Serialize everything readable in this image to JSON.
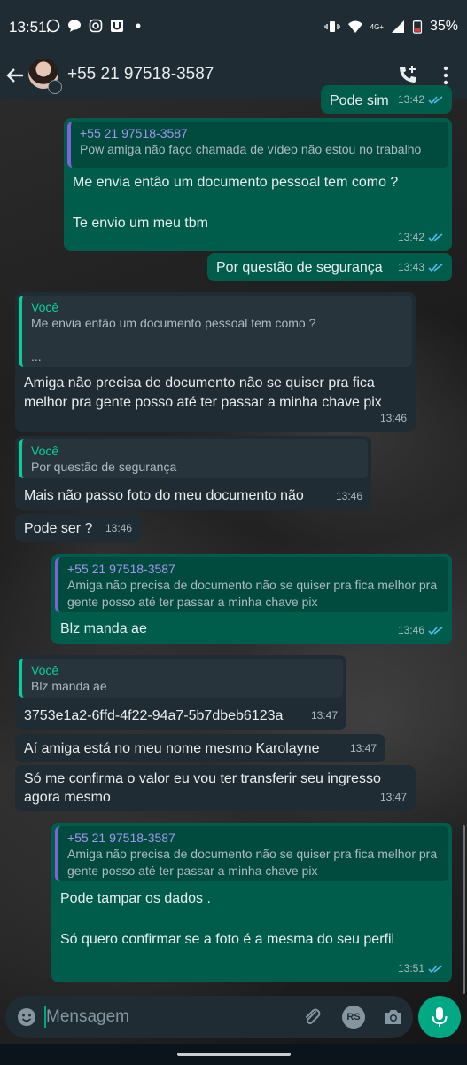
{
  "status_bar": {
    "time": "13:51",
    "network": "4G+",
    "battery": "35%"
  },
  "header": {
    "contact_name": "+55 21 97518-3587"
  },
  "messages": [
    {
      "dir": "out",
      "text": "Pode sim",
      "time": "13:42"
    },
    {
      "dir": "out",
      "quote_author": "+55 21 97518-3587",
      "quote_text": "Pow amiga não faço chamada de vídeo não estou no trabalho",
      "text": "Me envia então um documento pessoal tem como ?\n\nTe envio um meu tbm",
      "time": "13:42"
    },
    {
      "dir": "out",
      "text": "Por questão de segurança",
      "time": "13:43"
    },
    {
      "dir": "in",
      "quote_author": "Você",
      "quote_text": "Me envia então um documento pessoal tem como ?\n\n...",
      "text": "Amiga não precisa de documento não se quiser pra fica melhor pra gente posso até ter passar a minha chave pix",
      "time": "13:46"
    },
    {
      "dir": "in",
      "quote_author": "Você",
      "quote_text": "Por questão de segurança",
      "text": "Mais não passo foto do meu documento não",
      "time": "13:46"
    },
    {
      "dir": "in",
      "text": "Pode ser ?",
      "time": "13:46"
    },
    {
      "dir": "out",
      "quote_author": "+55 21 97518-3587",
      "quote_text": "Amiga não precisa de documento não se quiser pra fica melhor pra gente posso até ter passar a minha chave pix",
      "text": "Blz manda ae",
      "time": "13:46"
    },
    {
      "dir": "in",
      "quote_author": "Você",
      "quote_text": "Blz manda ae",
      "text": "3753e1a2-6ffd-4f22-94a7-5b7dbeb6123a",
      "time": "13:47"
    },
    {
      "dir": "in",
      "text": "Aí amiga está no meu nome mesmo Karolayne",
      "time": "13:47"
    },
    {
      "dir": "in",
      "text": "Só me confirma o valor eu vou ter transferir seu ingresso agora mesmo",
      "time": "13:47"
    },
    {
      "dir": "out",
      "quote_author": "+55 21 97518-3587",
      "quote_text": "Amiga não precisa de documento não se quiser pra fica melhor pra gente posso até ter passar a minha chave pix",
      "text": "Pode tampar os dados .\n\nSó quero confirmar se a foto é a mesma do seu perfil",
      "time": "13:51"
    }
  ],
  "composer": {
    "placeholder": "Mensagem",
    "rs_label": "RS"
  },
  "colors": {
    "outgoing_bubble": "#005c4b",
    "incoming_bubble": "#202c33",
    "accent": "#00a884",
    "read_ticks": "#53bdeb"
  }
}
